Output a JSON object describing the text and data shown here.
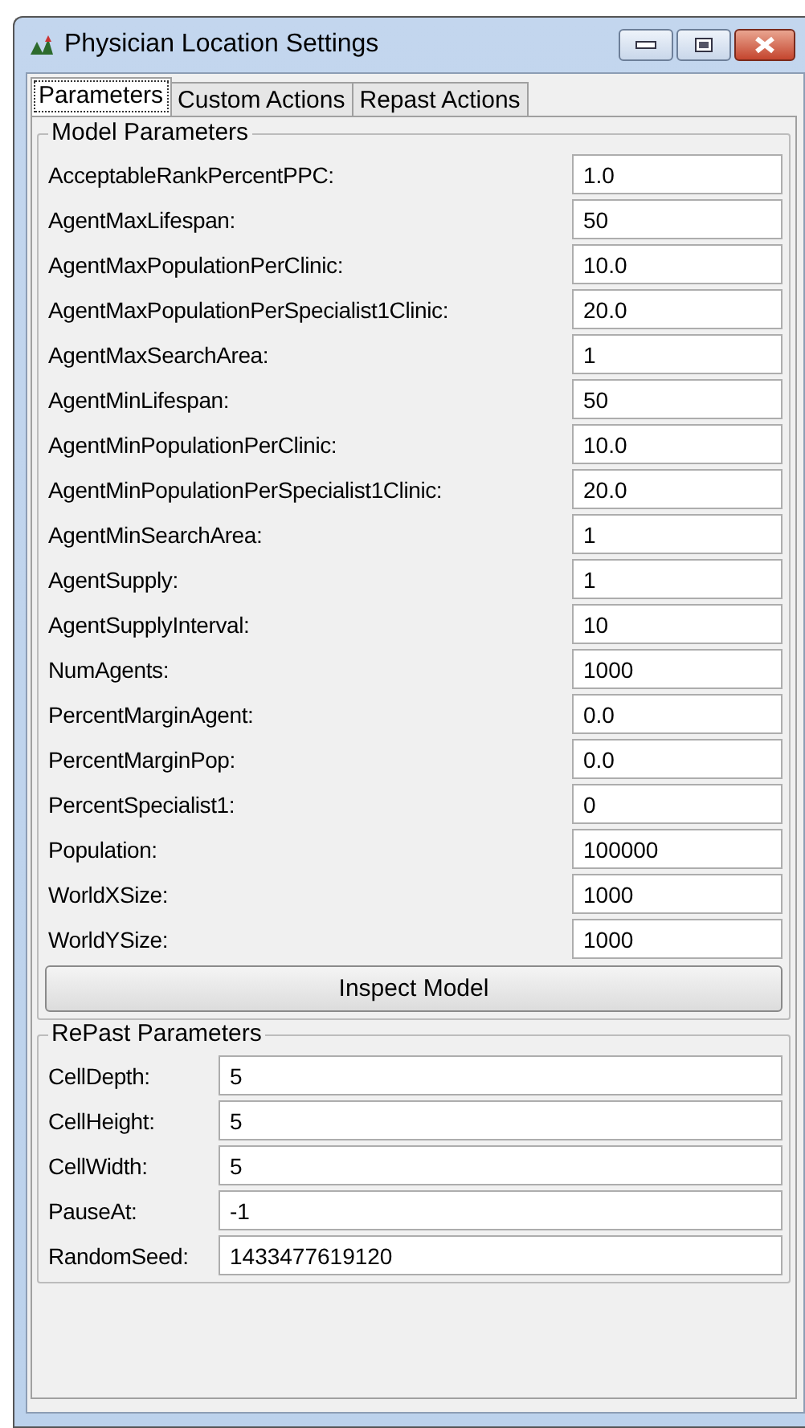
{
  "window": {
    "title": "Physician Location Settings"
  },
  "tabs": [
    {
      "label": "Parameters",
      "selected": true
    },
    {
      "label": "Custom Actions",
      "selected": false
    },
    {
      "label": "Repast Actions",
      "selected": false
    }
  ],
  "model_parameters": {
    "title": "Model Parameters",
    "rows": [
      {
        "label": "AcceptableRankPercentPPC:",
        "value": "1.0"
      },
      {
        "label": "AgentMaxLifespan:",
        "value": "50"
      },
      {
        "label": "AgentMaxPopulationPerClinic:",
        "value": "10.0"
      },
      {
        "label": "AgentMaxPopulationPerSpecialist1Clinic:",
        "value": "20.0"
      },
      {
        "label": "AgentMaxSearchArea:",
        "value": "1"
      },
      {
        "label": "AgentMinLifespan:",
        "value": "50"
      },
      {
        "label": "AgentMinPopulationPerClinic:",
        "value": "10.0"
      },
      {
        "label": "AgentMinPopulationPerSpecialist1Clinic:",
        "value": "20.0"
      },
      {
        "label": "AgentMinSearchArea:",
        "value": "1"
      },
      {
        "label": "AgentSupply:",
        "value": "1"
      },
      {
        "label": "AgentSupplyInterval:",
        "value": "10"
      },
      {
        "label": "NumAgents:",
        "value": "1000"
      },
      {
        "label": "PercentMarginAgent:",
        "value": "0.0"
      },
      {
        "label": "PercentMarginPop:",
        "value": "0.0"
      },
      {
        "label": "PercentSpecialist1:",
        "value": "0"
      },
      {
        "label": "Population:",
        "value": "100000"
      },
      {
        "label": "WorldXSize:",
        "value": "1000"
      },
      {
        "label": "WorldYSize:",
        "value": "1000"
      }
    ],
    "button": "Inspect Model"
  },
  "repast_parameters": {
    "title": "RePast Parameters",
    "rows": [
      {
        "label": "CellDepth:",
        "value": "5"
      },
      {
        "label": "CellHeight:",
        "value": "5"
      },
      {
        "label": "CellWidth:",
        "value": "5"
      },
      {
        "label": "PauseAt:",
        "value": "-1"
      },
      {
        "label": "RandomSeed:",
        "value": "1433477619120"
      }
    ]
  }
}
